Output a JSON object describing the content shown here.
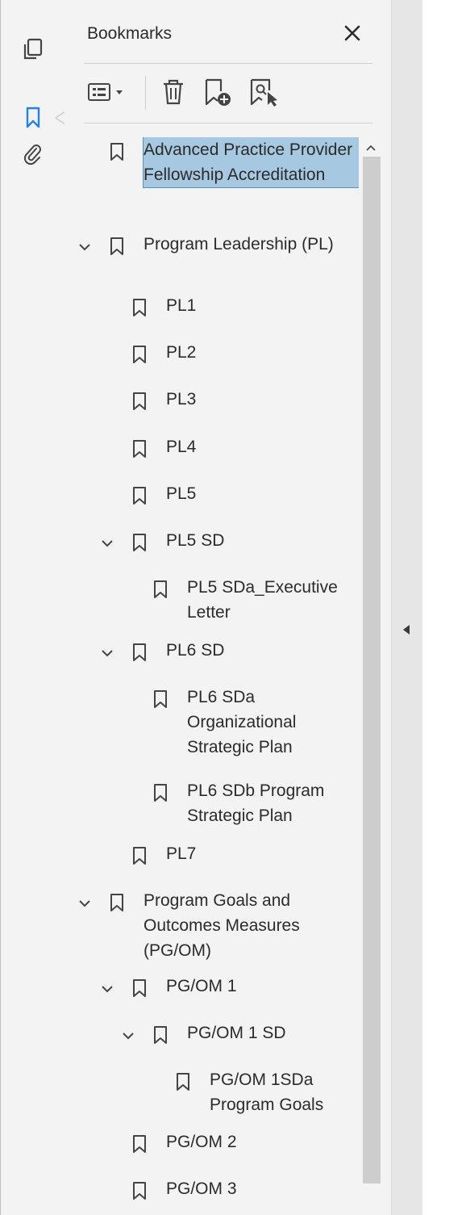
{
  "panel": {
    "title": "Bookmarks"
  },
  "rail": {
    "icons": [
      "pages-icon",
      "bookmark-icon",
      "attachment-icon"
    ],
    "active": "bookmark-icon"
  },
  "toolbar": {
    "icons": [
      "options-menu-icon",
      "delete-bookmark-icon",
      "new-bookmark-icon",
      "find-current-bookmark-icon"
    ]
  },
  "bookmarks": [
    {
      "label": "Advanced Practice Provider Fellowship Accreditation",
      "level": 0,
      "expanded": null,
      "selected": true
    },
    {
      "label": "Program Leadership (PL)",
      "level": 0,
      "expanded": true,
      "selected": false
    },
    {
      "label": "PL1",
      "level": 1,
      "expanded": null,
      "selected": false
    },
    {
      "label": "PL2",
      "level": 1,
      "expanded": null,
      "selected": false
    },
    {
      "label": "PL3",
      "level": 1,
      "expanded": null,
      "selected": false
    },
    {
      "label": "PL4",
      "level": 1,
      "expanded": null,
      "selected": false
    },
    {
      "label": "PL5",
      "level": 1,
      "expanded": null,
      "selected": false
    },
    {
      "label": "PL5 SD",
      "level": 1,
      "expanded": true,
      "selected": false
    },
    {
      "label": "PL5 SDa_Executive Letter",
      "level": 2,
      "expanded": null,
      "selected": false
    },
    {
      "label": "PL6 SD",
      "level": 1,
      "expanded": true,
      "selected": false
    },
    {
      "label": "PL6 SDa Organizational Strategic Plan",
      "level": 2,
      "expanded": null,
      "selected": false
    },
    {
      "label": "PL6 SDb Program Strategic Plan",
      "level": 2,
      "expanded": null,
      "selected": false
    },
    {
      "label": "PL7",
      "level": 1,
      "expanded": null,
      "selected": false
    },
    {
      "label": "Program Goals and Outcomes Measures (PG/OM)",
      "level": 0,
      "expanded": true,
      "selected": false
    },
    {
      "label": "PG/OM 1",
      "level": 1,
      "expanded": true,
      "selected": false
    },
    {
      "label": "PG/OM 1 SD",
      "level": 2,
      "expanded": true,
      "selected": false
    },
    {
      "label": "PG/OM 1SDa Program Goals",
      "level": 3,
      "expanded": null,
      "selected": false
    },
    {
      "label": "PG/OM 2",
      "level": 1,
      "expanded": null,
      "selected": false
    },
    {
      "label": "PG/OM 3",
      "level": 1,
      "expanded": null,
      "selected": false
    }
  ],
  "colors": {
    "panel_bg": "#f3f3f3",
    "selection_bg": "#a6c8e0",
    "selection_border": "#5a8fb8",
    "active_icon": "#2680eb",
    "scroll_thumb": "#cdcdcd"
  }
}
